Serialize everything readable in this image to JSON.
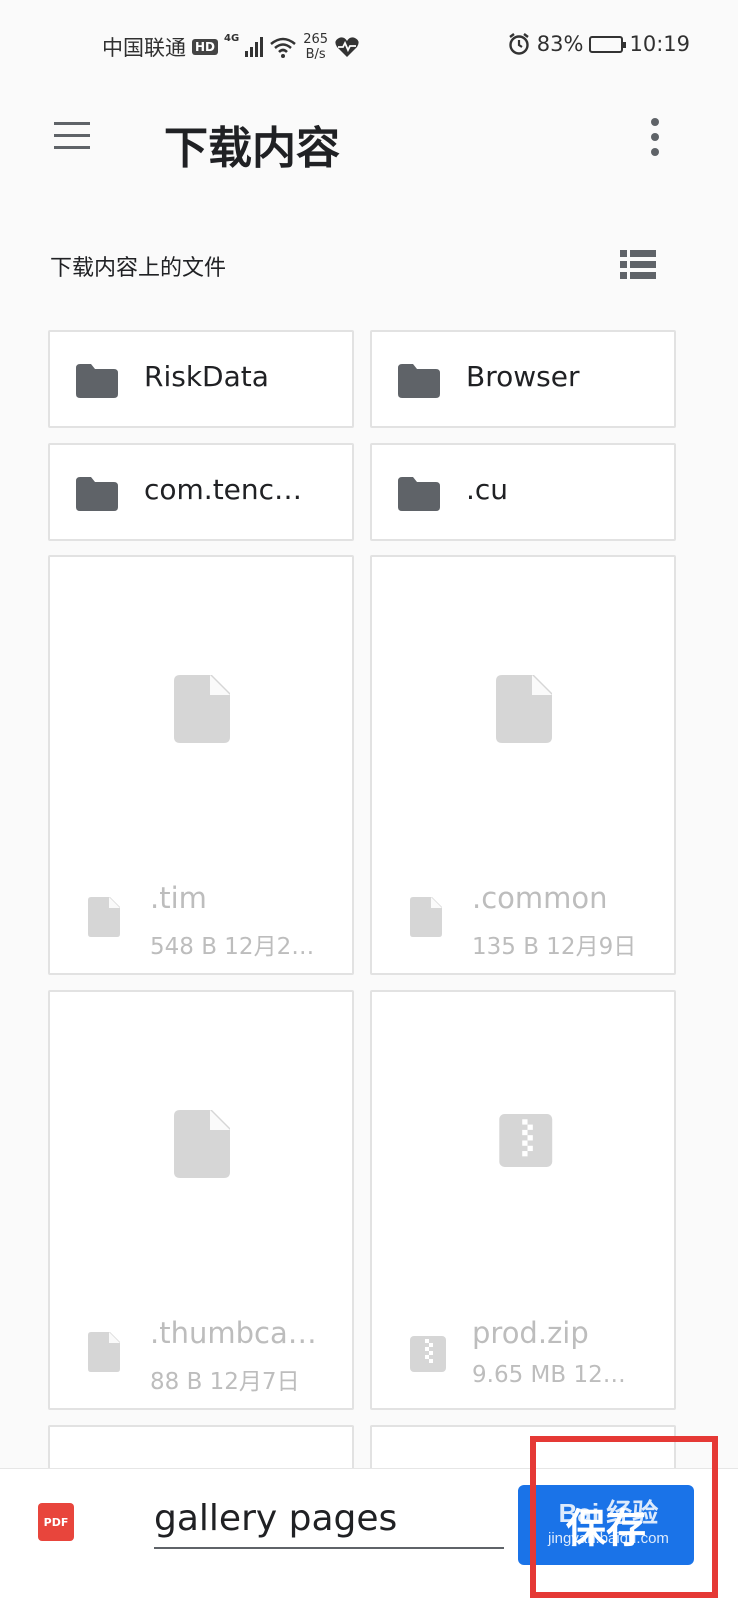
{
  "status_bar": {
    "carrier": "中国联通",
    "hd": "HD",
    "network": "4G",
    "speed_value": "265",
    "speed_unit": "B/s",
    "battery": "83%",
    "battery_level": 0.83,
    "time": "10:19"
  },
  "app_bar": {
    "title": "下载内容"
  },
  "section": {
    "title": "下载内容上的文件"
  },
  "folders": [
    {
      "name": "RiskData"
    },
    {
      "name": "Browser"
    },
    {
      "name": "com.tenc…"
    },
    {
      "name": ".cu"
    }
  ],
  "files": [
    {
      "name": ".tim",
      "meta": "548 B 12月2…",
      "icon": "file-icon"
    },
    {
      "name": ".common",
      "meta": "135 B 12月9日",
      "icon": "file-icon"
    },
    {
      "name": ".thumbca…",
      "meta": "88 B 12月7日",
      "icon": "file-icon"
    },
    {
      "name": "prod.zip",
      "meta": "9.65 MB 12…",
      "icon": "zip-icon"
    }
  ],
  "bottom_bar": {
    "file_type": "PDF",
    "filename_value": "gallery pages",
    "save_label": "保存"
  },
  "watermark": {
    "line1": "Bai 经验",
    "line2": "jingyan.baidu.com"
  },
  "colors": {
    "accent": "#1a73e8",
    "pdf": "#e8453c",
    "highlight": "#e53935",
    "icon_grey": "#5f6368"
  }
}
